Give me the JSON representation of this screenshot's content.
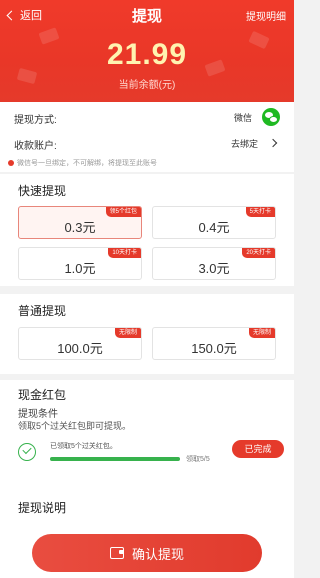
{
  "header": {
    "back_label": "返回",
    "title": "提现",
    "detail_link": "提现明细",
    "balance": "21.99",
    "balance_label": "当前余额(元)"
  },
  "account": {
    "method_label": "提现方式:",
    "method_value": "微信",
    "receiver_label": "收款账户:",
    "receiver_value": "去绑定",
    "tip": "微信号一旦绑定，不可解绑，将提现至此账号"
  },
  "quick": {
    "title": "快速提现",
    "options": [
      {
        "value": "0.3元",
        "tag": "领5个红包",
        "selected": true
      },
      {
        "value": "0.4元",
        "tag": "5天打卡",
        "selected": false
      },
      {
        "value": "1.0元",
        "tag": "10天打卡",
        "selected": false
      },
      {
        "value": "3.0元",
        "tag": "20天打卡",
        "selected": false
      }
    ]
  },
  "normal": {
    "title": "普通提现",
    "options": [
      {
        "value": "100.0元",
        "tag": "无限制"
      },
      {
        "value": "150.0元",
        "tag": "无限制"
      }
    ]
  },
  "redpacket": {
    "title": "现金红包",
    "cond_title": "提现条件",
    "cond_desc": "领取5个过关红包即可提现。",
    "task_text": "已领取5个过关红包。",
    "progress_text": "领取5/5",
    "progress": 1.0,
    "done_label": "已完成"
  },
  "explain": {
    "title": "提现说明"
  },
  "footer": {
    "confirm_label": "确认提现"
  },
  "colors": {
    "brand_red": "#e53a2b",
    "amount_yellow": "#fff3b0",
    "success_green": "#37b24d",
    "wechat_green": "#1fb922"
  }
}
